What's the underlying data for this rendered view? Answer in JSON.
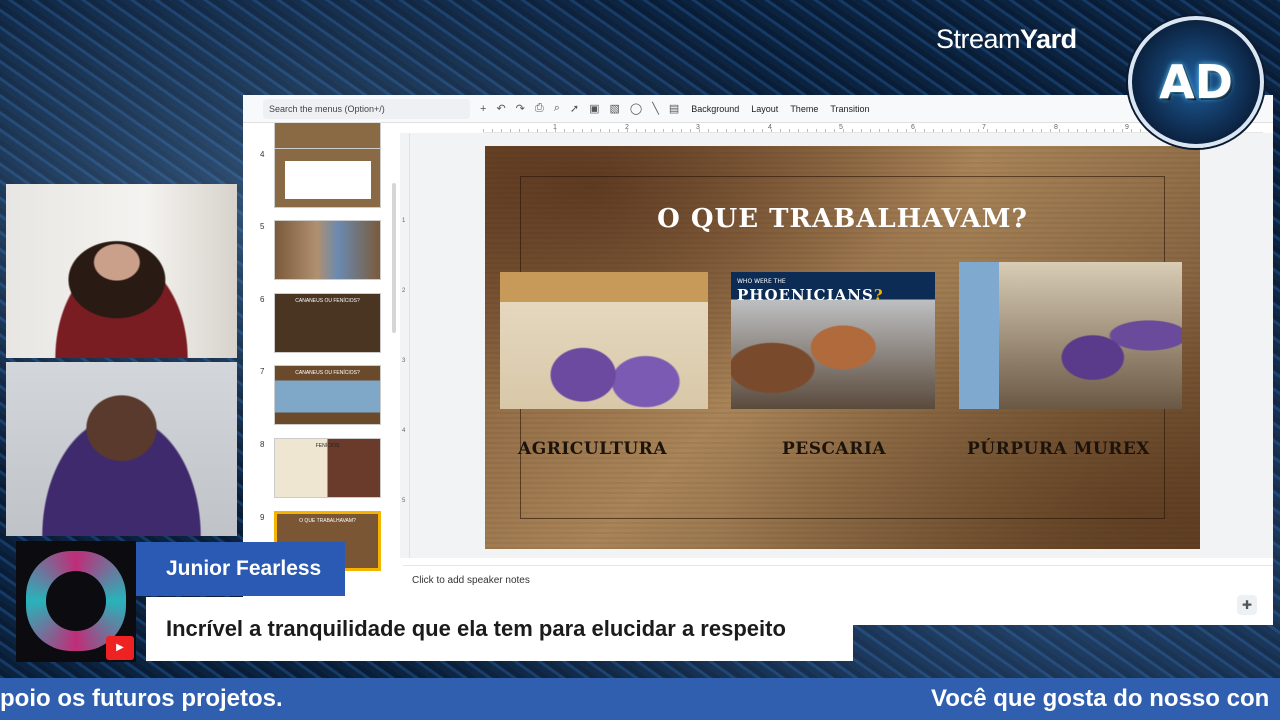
{
  "branding": {
    "stream_label_light": "Stream",
    "stream_label_bold": "Yard",
    "channel_logo_text": "AD"
  },
  "toolbar": {
    "search_placeholder": "Search the menus (Option+/)",
    "background": "Background",
    "layout": "Layout",
    "theme": "Theme",
    "transition": "Transition"
  },
  "ruler": {
    "marks": [
      "1",
      "2",
      "3",
      "4",
      "5",
      "6",
      "7",
      "8",
      "9"
    ],
    "vmarks": [
      "1",
      "2",
      "3",
      "4",
      "5"
    ]
  },
  "thumbnails": [
    {
      "num": "4",
      "title": ""
    },
    {
      "num": "5",
      "title": ""
    },
    {
      "num": "6",
      "title": "CANANEUS OU FENÍCIOS?"
    },
    {
      "num": "7",
      "title": "CANANEUS OU FENÍCIOS?"
    },
    {
      "num": "8",
      "title": "FENÍCIOS"
    },
    {
      "num": "9",
      "title": "O QUE TRABALHAVAM?"
    }
  ],
  "slide": {
    "title": "O QUE TRABALHAVAM?",
    "image_caption": "WHO WERE THE",
    "image_title": "PHOENICIANS",
    "image_title_mark": "?",
    "labels": [
      "AGRICULTURA",
      "PESCARIA",
      "PÚRPURA MUREX"
    ]
  },
  "notes_placeholder": "Click to add speaker notes",
  "lower_third": {
    "name": "Junior Fearless",
    "message": "Incrível a tranquilidade que ela tem para elucidar a respeito",
    "platform_icon": "youtube-icon"
  },
  "ticker": {
    "left_text": "poio os futuros projetos.",
    "right_text": "Você que gosta do nosso con"
  },
  "colors": {
    "accent_blue": "#2a5ab3",
    "ticker_blue": "#2f5fae",
    "selected_thumb": "#f4b400"
  }
}
